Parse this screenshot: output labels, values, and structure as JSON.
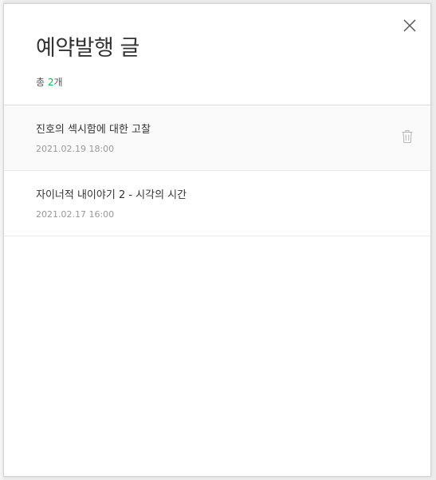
{
  "panel": {
    "title": "예약발행 글",
    "count_prefix": "총 ",
    "count_value": "2",
    "count_suffix": "개"
  },
  "icons": {
    "close": "close-icon",
    "delete": "trash-icon"
  },
  "colors": {
    "accent": "#00c73c",
    "title_text": "#333333",
    "date_text": "#999999"
  },
  "posts": [
    {
      "title": "진호의 섹시함에 대한 고찰",
      "date": "2021.02.19 18:00"
    },
    {
      "title": "자이너적 내이야기 2 - 시각의 시간",
      "date": "2021.02.17 16:00"
    }
  ]
}
